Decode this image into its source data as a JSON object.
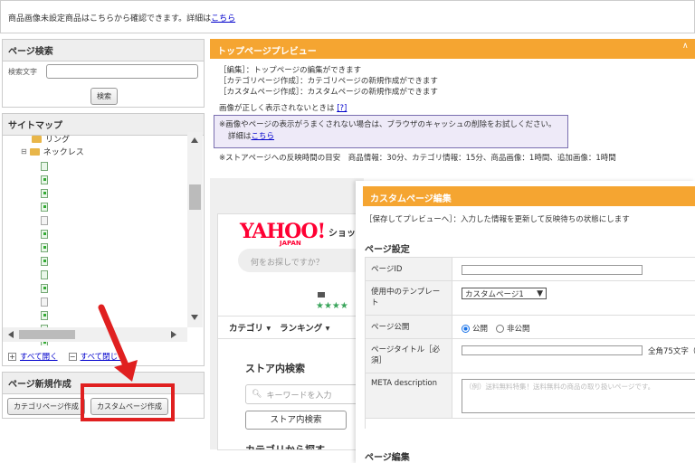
{
  "banner": {
    "text": "商品画像未設定商品はこちらから確認できます。詳細は",
    "link": "こちら"
  },
  "search_panel": {
    "title": "ページ検索",
    "label": "検索文字",
    "button": "検索"
  },
  "sitemap": {
    "title": "サイトマップ",
    "folders": [
      "リング",
      "ネックレス"
    ],
    "expand_all": "すべて開く",
    "collapse_all": "すべて閉じる"
  },
  "new_page": {
    "title": "ページ新規作成",
    "category_button": "カテゴリページ作成",
    "custom_button": "カスタムページ作成"
  },
  "preview": {
    "title": "トップページプレビュー",
    "lines": [
      "［編集］：トップページの編集ができます",
      "［カテゴリページ作成］：カテゴリページの新規作成ができます",
      "［カスタムページ作成］：カスタムページの新規作成ができます"
    ],
    "image_note": "画像が正しく表示されないときは",
    "help_link": "[?]",
    "cache_note": "※画像やページの表示がうまくされない場合は、ブラウザのキャッシュの削除をお試しください。",
    "detail_prefix": "詳細は",
    "detail_link": "こちら",
    "reflect_note": "※ストアページへの反映時間の目安　商品情報：30分、カテゴリ情報：15分、商品画像：1時間、追加画像：1時間"
  },
  "store": {
    "logo": "YAHOO!",
    "logo_sub": "JAPAN",
    "shop": "ショッ",
    "search_placeholder": "何をお探しですか？",
    "stars": "★★★★",
    "nav": [
      "カテゴリ",
      "ランキング"
    ],
    "store_search_title": "ストア内検索",
    "keyword_placeholder": "キーワードを入力",
    "store_search_button": "ストア内検索",
    "from_category": "カテゴリから探す"
  },
  "custom_edit": {
    "title": "カスタムページ編集",
    "note": "［保存してプレビューへ］：入力した情報を更新して反映待ちの状態にします",
    "section": "ページ設定",
    "fields": {
      "page_id": "ページID",
      "template": "使用中のテンプレート",
      "template_value": "カスタムページ1",
      "publish": "ページ公開",
      "public": "公開",
      "private": "非公開",
      "page_title": "ページタイトル［必須］",
      "char_limit": "全角75文字（",
      "meta": "META description",
      "meta_placeholder": "（例）送料無料特集！送料無料の商品の取り扱いページです。"
    },
    "section2": "ページ編集"
  },
  "colors": {
    "orange": "#f5a531",
    "highlight": "#e02020"
  }
}
